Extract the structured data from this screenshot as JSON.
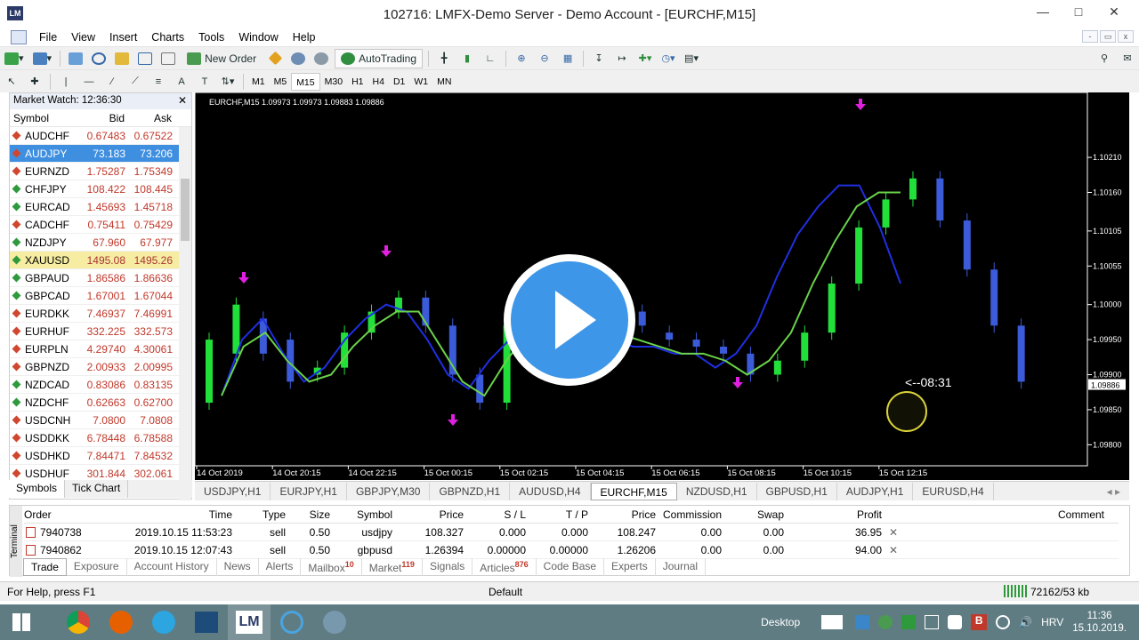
{
  "window": {
    "title": "102716: LMFX-Demo Server - Demo Account - [EURCHF,M15]",
    "logo": "LM"
  },
  "menu": [
    "File",
    "View",
    "Insert",
    "Charts",
    "Tools",
    "Window",
    "Help"
  ],
  "toolbar": {
    "new_order": "New Order",
    "auto_trading": "AutoTrading"
  },
  "timeframes": [
    "M1",
    "M5",
    "M15",
    "M30",
    "H1",
    "H4",
    "D1",
    "W1",
    "MN"
  ],
  "active_timeframe": "M15",
  "market_watch": {
    "title": "Market Watch: 12:36:30",
    "columns": [
      "Symbol",
      "Bid",
      "Ask"
    ],
    "rows": [
      {
        "symbol": "AUDCHF",
        "bid": "0.67483",
        "ask": "0.67522",
        "dir": "dn",
        "state": ""
      },
      {
        "symbol": "AUDJPY",
        "bid": "73.183",
        "ask": "73.206",
        "dir": "dn",
        "state": "sel"
      },
      {
        "symbol": "EURNZD",
        "bid": "1.75287",
        "ask": "1.75349",
        "dir": "dn",
        "state": ""
      },
      {
        "symbol": "CHFJPY",
        "bid": "108.422",
        "ask": "108.445",
        "dir": "up",
        "state": ""
      },
      {
        "symbol": "EURCAD",
        "bid": "1.45693",
        "ask": "1.45718",
        "dir": "up",
        "state": ""
      },
      {
        "symbol": "CADCHF",
        "bid": "0.75411",
        "ask": "0.75429",
        "dir": "dn",
        "state": ""
      },
      {
        "symbol": "NZDJPY",
        "bid": "67.960",
        "ask": "67.977",
        "dir": "up",
        "state": ""
      },
      {
        "symbol": "XAUUSD",
        "bid": "1495.08",
        "ask": "1495.26",
        "dir": "up",
        "state": "gold"
      },
      {
        "symbol": "GBPAUD",
        "bid": "1.86586",
        "ask": "1.86636",
        "dir": "up",
        "state": ""
      },
      {
        "symbol": "GBPCAD",
        "bid": "1.67001",
        "ask": "1.67044",
        "dir": "up",
        "state": ""
      },
      {
        "symbol": "EURDKK",
        "bid": "7.46937",
        "ask": "7.46991",
        "dir": "dn",
        "state": ""
      },
      {
        "symbol": "EURHUF",
        "bid": "332.225",
        "ask": "332.573",
        "dir": "dn",
        "state": ""
      },
      {
        "symbol": "EURPLN",
        "bid": "4.29740",
        "ask": "4.30061",
        "dir": "dn",
        "state": ""
      },
      {
        "symbol": "GBPNZD",
        "bid": "2.00933",
        "ask": "2.00995",
        "dir": "dn",
        "state": ""
      },
      {
        "symbol": "NZDCAD",
        "bid": "0.83086",
        "ask": "0.83135",
        "dir": "up",
        "state": ""
      },
      {
        "symbol": "NZDCHF",
        "bid": "0.62663",
        "ask": "0.62700",
        "dir": "up",
        "state": ""
      },
      {
        "symbol": "USDCNH",
        "bid": "7.0800",
        "ask": "7.0808",
        "dir": "dn",
        "state": ""
      },
      {
        "symbol": "USDDKK",
        "bid": "6.78448",
        "ask": "6.78588",
        "dir": "dn",
        "state": ""
      },
      {
        "symbol": "USDHKD",
        "bid": "7.84471",
        "ask": "7.84532",
        "dir": "dn",
        "state": ""
      },
      {
        "symbol": "USDHUF",
        "bid": "301.844",
        "ask": "302.061",
        "dir": "dn",
        "state": ""
      }
    ],
    "tabs": [
      "Symbols",
      "Tick Chart"
    ]
  },
  "chart_data": {
    "type": "line",
    "title": "EURCHF,M15  1.09973 1.09973 1.09883 1.09886",
    "y_ticks": [
      "1.10210",
      "1.10160",
      "1.10105",
      "1.10055",
      "1.10000",
      "1.09950",
      "1.09900",
      "1.09850",
      "1.09800"
    ],
    "ylim": [
      1.0977,
      1.1029
    ],
    "x_ticks": [
      "14 Oct 2019",
      "14 Oct 20:15",
      "14 Oct 22:15",
      "15 Oct 00:15",
      "15 Oct 02:15",
      "15 Oct 04:15",
      "15 Oct 06:15",
      "15 Oct 08:15",
      "15 Oct 10:15",
      "15 Oct 12:15"
    ],
    "current_price": "1.09886",
    "countdown": "<--08:31",
    "series": [
      {
        "values": [
          1.0987,
          1.0995,
          1.0998,
          1.0993,
          1.0989,
          1.0991,
          1.0995,
          1.0998,
          1.1,
          1.0999,
          1.0995,
          1.099,
          1.0988,
          1.0992,
          1.0995,
          1.0997,
          1.0999,
          1.0998,
          1.0996,
          1.0995,
          1.0994,
          1.0994,
          1.0993,
          1.0993,
          1.0991,
          1.0993,
          1.0997,
          1.1004,
          1.101,
          1.1014,
          1.1017,
          1.1017,
          1.1011,
          1.1003
        ]
      },
      {
        "values": [
          1.0987,
          1.0994,
          1.0996,
          1.0992,
          1.0989,
          1.099,
          1.0994,
          1.0997,
          1.0999,
          1.0999,
          1.0994,
          1.0989,
          1.0987,
          1.0992,
          1.0996,
          1.0998,
          1.0999,
          1.0998,
          1.0996,
          1.0995,
          1.0994,
          1.0993,
          1.0993,
          1.0992,
          1.099,
          1.0992,
          1.0996,
          1.1003,
          1.1009,
          1.1014,
          1.1016,
          1.1016
        ]
      }
    ],
    "candles": [
      [
        1.0986,
        1.0995
      ],
      [
        1.0993,
        1.1
      ],
      [
        1.0998,
        1.0993
      ],
      [
        1.0995,
        1.0989
      ],
      [
        1.099,
        1.0991
      ],
      [
        1.0991,
        1.0996
      ],
      [
        1.0996,
        1.0999
      ],
      [
        1.0999,
        1.1001
      ],
      [
        1.1001,
        1.0997
      ],
      [
        1.0997,
        1.099
      ],
      [
        1.099,
        1.0986
      ],
      [
        1.0986,
        1.0997
      ],
      [
        1.0997,
        1.0998
      ],
      [
        1.0998,
        1.0999
      ],
      [
        1.0999,
        1.1
      ],
      [
        1.1,
        1.0999
      ],
      [
        1.0999,
        1.0997
      ],
      [
        1.0996,
        1.0995
      ],
      [
        1.0995,
        1.0994
      ],
      [
        1.0994,
        1.0993
      ],
      [
        1.0993,
        1.099
      ],
      [
        1.099,
        1.0992
      ],
      [
        1.0992,
        1.0996
      ],
      [
        1.0996,
        1.1003
      ],
      [
        1.1003,
        1.1011
      ],
      [
        1.1011,
        1.1015
      ],
      [
        1.1015,
        1.1018
      ],
      [
        1.1018,
        1.1012
      ],
      [
        1.1012,
        1.1005
      ],
      [
        1.1005,
        1.0997
      ],
      [
        1.0997,
        1.0989
      ]
    ]
  },
  "chart_tabs": [
    "USDJPY,H1",
    "EURJPY,H1",
    "GBPJPY,M30",
    "GBPNZD,H1",
    "AUDUSD,H4",
    "EURCHF,M15",
    "NZDUSD,H1",
    "GBPUSD,H1",
    "AUDJPY,H1",
    "EURUSD,H4"
  ],
  "active_chart_tab": "EURCHF,M15",
  "terminal": {
    "side_label": "Terminal",
    "columns": [
      "Order",
      "Time",
      "Type",
      "Size",
      "Symbol",
      "Price",
      "S / L",
      "T / P",
      "Price",
      "Commission",
      "Swap",
      "Profit",
      "Comment"
    ],
    "rows": [
      [
        "7940738",
        "2019.10.15 11:53:23",
        "sell",
        "0.50",
        "usdjpy",
        "108.327",
        "0.000",
        "0.000",
        "108.247",
        "0.00",
        "0.00",
        "36.95"
      ],
      [
        "7940862",
        "2019.10.15 12:07:43",
        "sell",
        "0.50",
        "gbpusd",
        "1.26394",
        "0.00000",
        "0.00000",
        "1.26206",
        "0.00",
        "0.00",
        "94.00"
      ]
    ],
    "tabs": [
      {
        "label": "Trade",
        "badge": ""
      },
      {
        "label": "Exposure",
        "badge": ""
      },
      {
        "label": "Account History",
        "badge": ""
      },
      {
        "label": "News",
        "badge": ""
      },
      {
        "label": "Alerts",
        "badge": ""
      },
      {
        "label": "Mailbox",
        "badge": "10"
      },
      {
        "label": "Market",
        "badge": "119"
      },
      {
        "label": "Signals",
        "badge": ""
      },
      {
        "label": "Articles",
        "badge": "876"
      },
      {
        "label": "Code Base",
        "badge": ""
      },
      {
        "label": "Experts",
        "badge": ""
      },
      {
        "label": "Journal",
        "badge": ""
      }
    ]
  },
  "status": {
    "help": "For Help, press F1",
    "profile": "Default",
    "traffic": "72162/53 kb"
  },
  "taskbar": {
    "desktop": "Desktop",
    "lang": "HRV",
    "time": "11:36",
    "date": "15.10.2019."
  }
}
